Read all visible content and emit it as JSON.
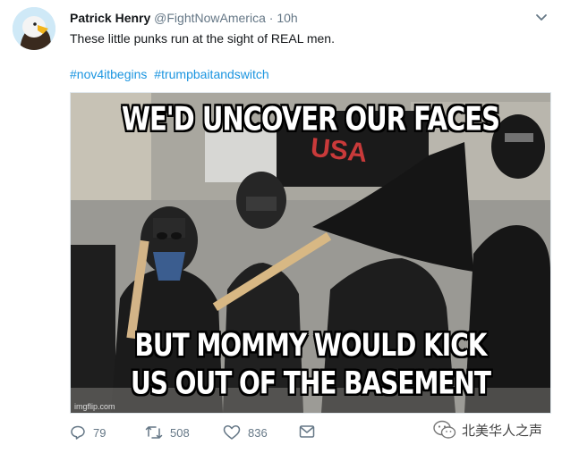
{
  "tweet": {
    "author_name": "Patrick Henry",
    "handle": "@FightNowAmerica",
    "separator": "·",
    "time": "10h",
    "text": "These little punks run at the sight of REAL men.",
    "hashtags": [
      "#nov4itbegins",
      "#trumpbaitandswitch"
    ],
    "avatar_icon": "eagle-avatar",
    "menu_icon": "chevron-down-icon"
  },
  "media": {
    "top_caption": "WE'D UNCOVER OUR FACES",
    "bottom_caption_line1": "BUT MOMMY WOULD KICK",
    "bottom_caption_line2": "US OUT OF THE BASEMENT",
    "sign_text": "USA",
    "watermark": "imgflip.com"
  },
  "actions": {
    "reply_count": "79",
    "retweet_count": "508",
    "like_count": "836"
  },
  "footer": {
    "wechat_label": "北美华人之声"
  },
  "colors": {
    "link": "#1b95e0",
    "muted": "#657786",
    "text": "#14171a"
  }
}
